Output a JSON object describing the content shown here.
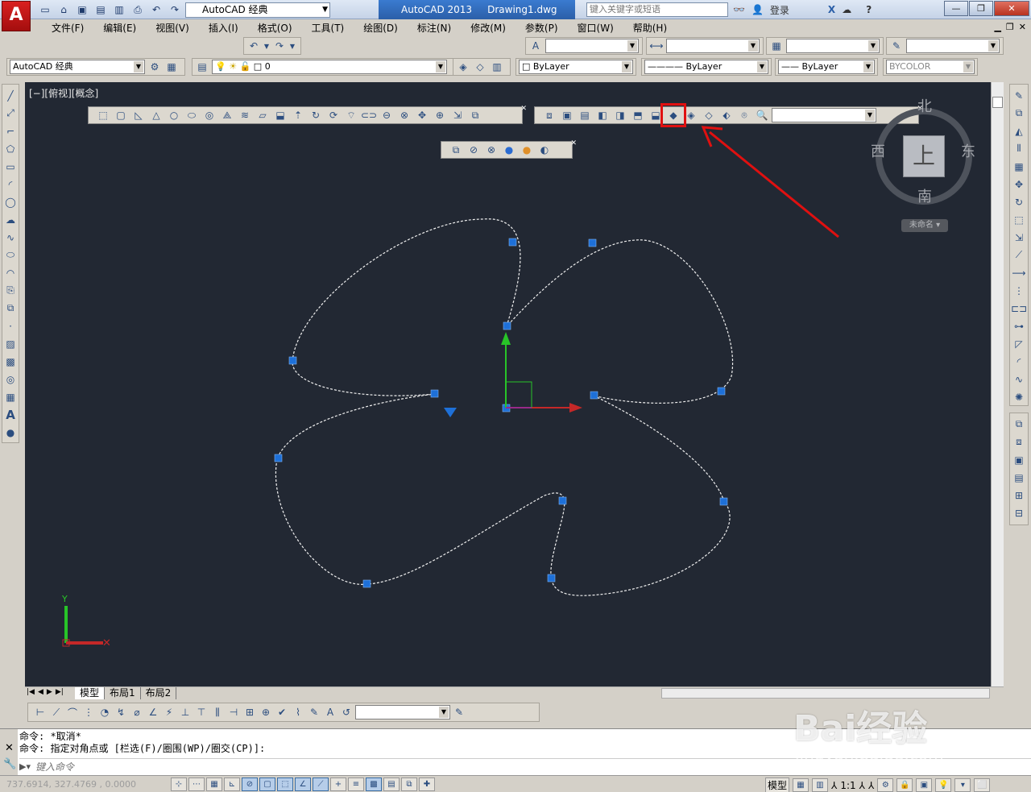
{
  "titlebar": {
    "logo": "A",
    "workspace": "AutoCAD 经典",
    "app_title": "AutoCAD 2013",
    "document": "Drawing1.dwg",
    "search_placeholder": "键入关键字或短语",
    "login": "登录",
    "help": "?",
    "minimize": "—",
    "restore": "❐",
    "close": "✕"
  },
  "menu": {
    "items": [
      "文件(F)",
      "编辑(E)",
      "视图(V)",
      "插入(I)",
      "格式(O)",
      "工具(T)",
      "绘图(D)",
      "标注(N)",
      "修改(M)",
      "参数(P)",
      "窗口(W)",
      "帮助(H)"
    ]
  },
  "toolbar": {
    "workspace_combo": "AutoCAD 经典",
    "layer_combo": "0",
    "color_combo": "ByLayer",
    "linetype_combo": "ByLayer",
    "lineweight_combo": "ByLayer",
    "plotstyle_combo": "BYCOLOR"
  },
  "canvas": {
    "viewport_label": "[−][俯视][概念]",
    "background": "#222833",
    "highlight_color": "#e01010"
  },
  "viewcube": {
    "north": "北",
    "south": "南",
    "east": "东",
    "west": "西",
    "face": "上",
    "named_view": "未命名"
  },
  "tabs": {
    "items": [
      "模型",
      "布局1",
      "布局2"
    ],
    "active": "模型"
  },
  "command": {
    "history": [
      "命令: *取消*",
      "命令: 指定对角点或 [栏选(F)/圈围(WP)/圈交(CP)]:"
    ],
    "input_placeholder": "键入命令"
  },
  "status": {
    "coords": "737.6914, 327.4769 , 0.0000",
    "model": "模型",
    "scale": "1:1"
  },
  "watermark": {
    "brand": "Bai经验",
    "url": "jingyan.baidu.com"
  }
}
